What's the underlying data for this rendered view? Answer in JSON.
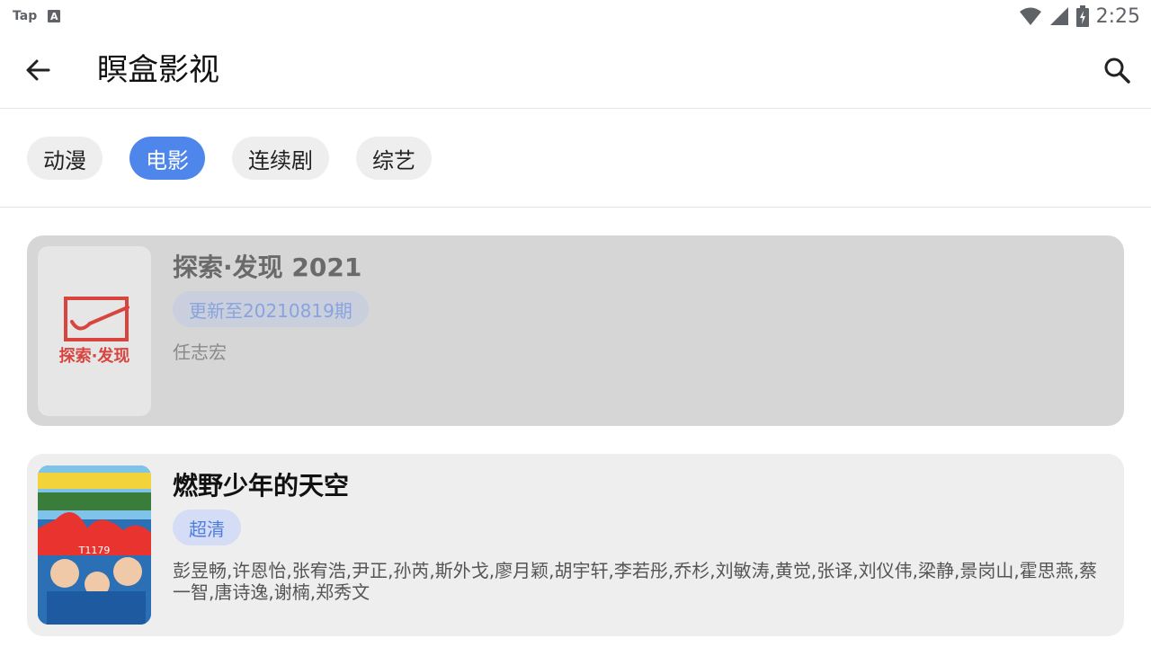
{
  "status_bar": {
    "left_label": "Tap",
    "a_icon_letter": "A",
    "time": "2:25",
    "icons": [
      "wifi-icon",
      "signal-icon",
      "battery-icon"
    ]
  },
  "app_bar": {
    "title": "瞑盒影视",
    "back_icon": "arrow-left-icon",
    "search_icon": "search-icon"
  },
  "tabs": [
    {
      "label": "动漫",
      "active": false
    },
    {
      "label": "电影",
      "active": true
    },
    {
      "label": "连续剧",
      "active": false
    },
    {
      "label": "综艺",
      "active": false
    }
  ],
  "colors": {
    "accent": "#4f86ec",
    "badge_bg": "#d4ddf5",
    "badge_text": "#4f7de0"
  },
  "items": [
    {
      "title": "探索·发现 2021",
      "badge": "更新至20210819期",
      "description": "任志宏",
      "thumb_text": "探索·发现"
    },
    {
      "title": "燃野少年的天空",
      "badge": "超清",
      "description": "彭昱畅,许恩怡,张宥浩,尹正,孙芮,斯外戈,廖月颖,胡宇轩,李若彤,乔杉,刘敏涛,黄觉,张译,刘仪伟,梁静,景岗山,霍思燕,蔡一智,唐诗逸,谢楠,郑秀文",
      "thumb_text": "T1179"
    }
  ]
}
